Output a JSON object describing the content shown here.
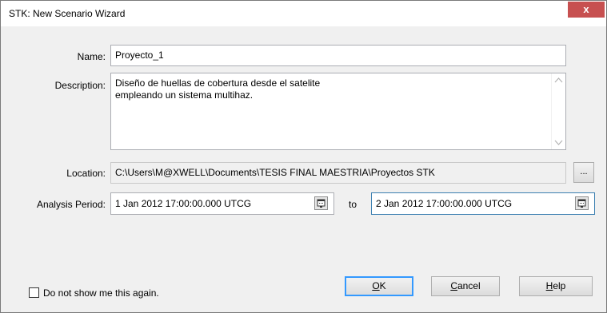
{
  "window": {
    "title": "STK: New Scenario Wizard",
    "close_glyph": "x"
  },
  "form": {
    "name_label": "Name:",
    "name_value": "Proyecto_1",
    "description_label": "Description:",
    "description_line1": "Diseño de huellas de cobertura desde el satelite",
    "description_line2": "empleando un sistema multihaz.",
    "location_label": "Location:",
    "location_value": "C:\\Users\\M@XWELL\\Documents\\TESIS FINAL MAESTRIA\\Proyectos STK",
    "browse_label": "...",
    "analysis_label": "Analysis Period:",
    "start_time": "1 Jan 2012 17:00:00.000 UTCG",
    "to_label": "to",
    "stop_time": "2 Jan 2012 17:00:00.000 UTCG"
  },
  "footer": {
    "checkbox_label": "Do not show me this again.",
    "ok_first": "O",
    "ok_rest": "K",
    "cancel_first": "C",
    "cancel_rest": "ancel",
    "help_first": "H",
    "help_rest": "elp"
  },
  "icons": [
    "close-icon",
    "calendar-icon",
    "scroll-up-icon",
    "scroll-down-icon"
  ]
}
